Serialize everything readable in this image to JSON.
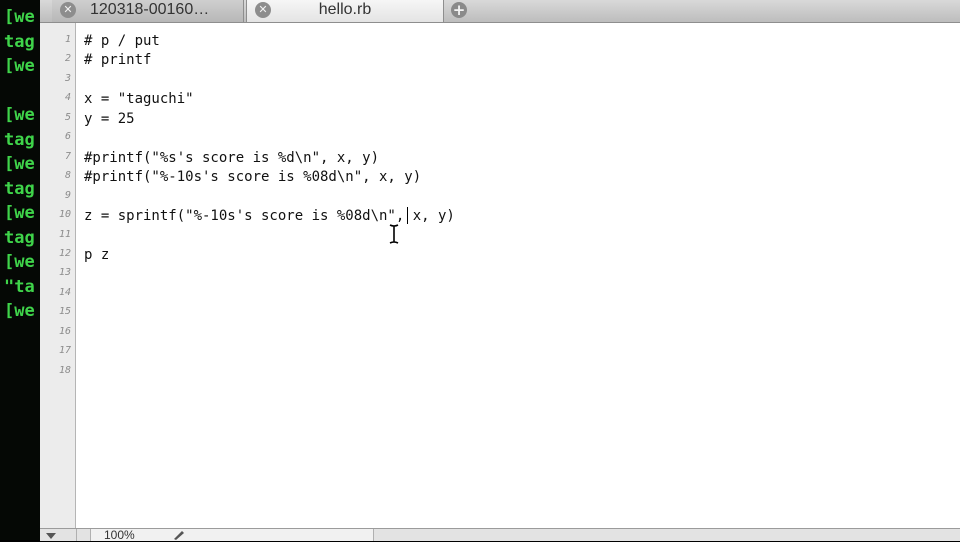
{
  "terminal": {
    "lines": [
      "[we",
      "tag",
      "[we",
      "",
      "[we",
      "tag",
      "[we",
      "tag",
      "[we",
      "tag",
      "[we",
      "\"ta",
      "[we"
    ]
  },
  "tabs": [
    {
      "label": "120318-00160…",
      "active": false
    },
    {
      "label": "hello.rb",
      "active": true
    }
  ],
  "editor": {
    "line_numbers": [
      "1",
      "2",
      "3",
      "4",
      "5",
      "6",
      "7",
      "8",
      "9",
      "10",
      "11",
      "12",
      "13",
      "14",
      "15",
      "16",
      "17",
      "18"
    ],
    "code_lines": [
      "# p / put",
      "# printf",
      "",
      "x = \"taguchi\"",
      "y = 25",
      "",
      "#printf(\"%s's score is %d\\n\", x, y)",
      "#printf(\"%-10s's score is %08d\\n\", x, y)",
      "",
      "z = sprintf(\"%-10s's score is %08d\\n\", x, y)",
      "",
      "p z",
      "",
      "",
      "",
      "",
      "",
      ""
    ]
  },
  "status": {
    "zoom": "100%"
  },
  "colors": {
    "terminal_text": "#3fd44a",
    "terminal_bg": "#050805",
    "gutter_bg": "#ececec",
    "editor_bg": "#ffffff"
  }
}
